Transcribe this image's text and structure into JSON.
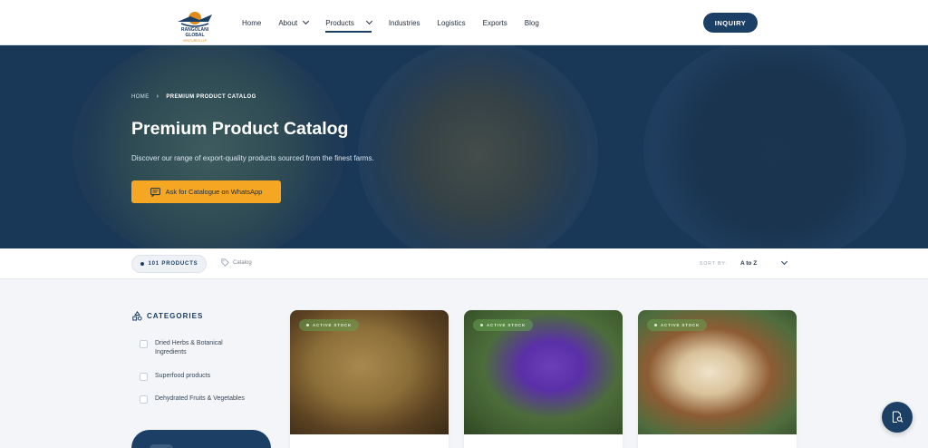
{
  "brand": {
    "logo_line1": "RANGOLANI GLOBAL",
    "logo_line2": "VENTURES LLP"
  },
  "nav": {
    "items": [
      {
        "label": "Home",
        "has_dropdown": false,
        "active": false
      },
      {
        "label": "About",
        "has_dropdown": true,
        "active": false
      },
      {
        "label": "Products",
        "has_dropdown": true,
        "active": true
      },
      {
        "label": "Industries",
        "has_dropdown": false,
        "active": false
      },
      {
        "label": "Logistics",
        "has_dropdown": false,
        "active": false
      },
      {
        "label": "Exports",
        "has_dropdown": false,
        "active": false
      },
      {
        "label": "Blog",
        "has_dropdown": false,
        "active": false
      }
    ],
    "inquiry_label": "INQUIRY"
  },
  "hero": {
    "breadcrumb_home": "HOME",
    "breadcrumb_current": "PREMIUM PRODUCT CATALOG",
    "title": "Premium Product Catalog",
    "subtitle": "Discover our range of export-quality products sourced from the finest farms.",
    "whatsapp_label": "Ask for Catalogue on WhatsApp"
  },
  "filter_bar": {
    "product_count": "101 PRODUCTS",
    "catalog_tag": "Catalog",
    "sort_label": "SORT BY:",
    "sort_value": "A to Z"
  },
  "categories": {
    "heading": "CATEGORIES",
    "items": [
      {
        "label": "Dried Herbs & Botanical Ingredients",
        "checked": false
      },
      {
        "label": "Superfood products",
        "checked": false
      },
      {
        "label": "Dehydrated Fruits & Vegetables",
        "checked": false
      }
    ]
  },
  "products": [
    {
      "badge": "ACTIVE STOCK"
    },
    {
      "badge": "ACTIVE STOCK"
    },
    {
      "badge": "ACTIVE STOCK"
    }
  ],
  "colors": {
    "primary": "#1c3f66",
    "accent": "#f5a623",
    "badge": "#64a050"
  }
}
